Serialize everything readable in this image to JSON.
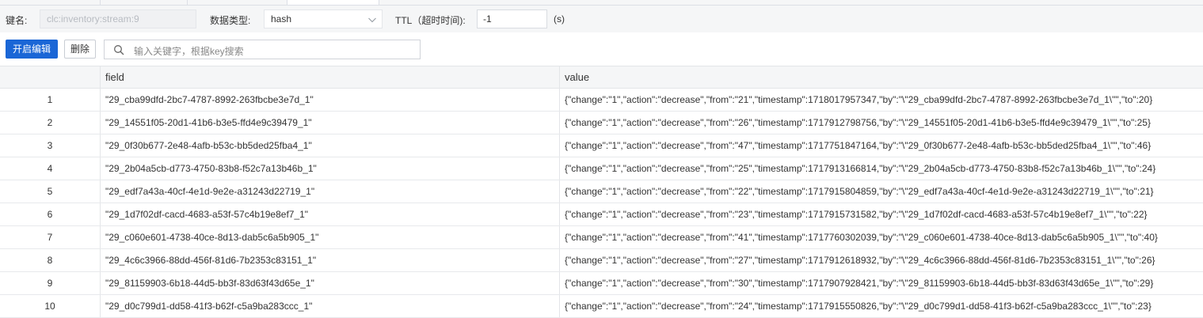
{
  "key_bar": {
    "key_label": "键名:",
    "key_value": "clc:inventory:stream:9",
    "type_label": "数据类型:",
    "type_value": "hash",
    "ttl_label": "TTL（超时时间):",
    "ttl_value": "-1",
    "ttl_unit": "(s)"
  },
  "toolbar": {
    "edit_label": "开启编辑",
    "delete_label": "删除",
    "search_placeholder": "输入关键字，根据key搜索"
  },
  "table": {
    "columns": [
      "field",
      "value"
    ],
    "rows": [
      {
        "index": "1",
        "field": "\"29_cba99dfd-2bc7-4787-8992-263fbcbe3e7d_1\"",
        "value": "{\"change\":\"1\",\"action\":\"decrease\",\"from\":\"21\",\"timestamp\":1718017957347,\"by\":\"\\\"29_cba99dfd-2bc7-4787-8992-263fbcbe3e7d_1\\\"\",\"to\":20}"
      },
      {
        "index": "2",
        "field": "\"29_14551f05-20d1-41b6-b3e5-ffd4e9c39479_1\"",
        "value": "{\"change\":\"1\",\"action\":\"decrease\",\"from\":\"26\",\"timestamp\":1717912798756,\"by\":\"\\\"29_14551f05-20d1-41b6-b3e5-ffd4e9c39479_1\\\"\",\"to\":25}"
      },
      {
        "index": "3",
        "field": "\"29_0f30b677-2e48-4afb-b53c-bb5ded25fba4_1\"",
        "value": "{\"change\":\"1\",\"action\":\"decrease\",\"from\":\"47\",\"timestamp\":1717751847164,\"by\":\"\\\"29_0f30b677-2e48-4afb-b53c-bb5ded25fba4_1\\\"\",\"to\":46}"
      },
      {
        "index": "4",
        "field": "\"29_2b04a5cb-d773-4750-83b8-f52c7a13b46b_1\"",
        "value": "{\"change\":\"1\",\"action\":\"decrease\",\"from\":\"25\",\"timestamp\":1717913166814,\"by\":\"\\\"29_2b04a5cb-d773-4750-83b8-f52c7a13b46b_1\\\"\",\"to\":24}"
      },
      {
        "index": "5",
        "field": "\"29_edf7a43a-40cf-4e1d-9e2e-a31243d22719_1\"",
        "value": "{\"change\":\"1\",\"action\":\"decrease\",\"from\":\"22\",\"timestamp\":1717915804859,\"by\":\"\\\"29_edf7a43a-40cf-4e1d-9e2e-a31243d22719_1\\\"\",\"to\":21}"
      },
      {
        "index": "6",
        "field": "\"29_1d7f02df-cacd-4683-a53f-57c4b19e8ef7_1\"",
        "value": "{\"change\":\"1\",\"action\":\"decrease\",\"from\":\"23\",\"timestamp\":1717915731582,\"by\":\"\\\"29_1d7f02df-cacd-4683-a53f-57c4b19e8ef7_1\\\"\",\"to\":22}"
      },
      {
        "index": "7",
        "field": "\"29_c060e601-4738-40ce-8d13-dab5c6a5b905_1\"",
        "value": "{\"change\":\"1\",\"action\":\"decrease\",\"from\":\"41\",\"timestamp\":1717760302039,\"by\":\"\\\"29_c060e601-4738-40ce-8d13-dab5c6a5b905_1\\\"\",\"to\":40}"
      },
      {
        "index": "8",
        "field": "\"29_4c6c3966-88dd-456f-81d6-7b2353c83151_1\"",
        "value": "{\"change\":\"1\",\"action\":\"decrease\",\"from\":\"27\",\"timestamp\":1717912618932,\"by\":\"\\\"29_4c6c3966-88dd-456f-81d6-7b2353c83151_1\\\"\",\"to\":26}"
      },
      {
        "index": "9",
        "field": "\"29_81159903-6b18-44d5-bb3f-83d63f43d65e_1\"",
        "value": "{\"change\":\"1\",\"action\":\"decrease\",\"from\":\"30\",\"timestamp\":1717907928421,\"by\":\"\\\"29_81159903-6b18-44d5-bb3f-83d63f43d65e_1\\\"\",\"to\":29}"
      },
      {
        "index": "10",
        "field": "\"29_d0c799d1-dd58-41f3-b62f-c5a9ba283ccc_1\"",
        "value": "{\"change\":\"1\",\"action\":\"decrease\",\"from\":\"24\",\"timestamp\":1717915550826,\"by\":\"\\\"29_d0c799d1-dd58-41f3-b62f-c5a9ba283ccc_1\\\"\",\"to\":23}"
      }
    ]
  },
  "icons": {
    "search": "search-icon",
    "dropdown": "chevron-down-icon"
  },
  "colors": {
    "primary": "#1a66d6",
    "toolbar_bg": "#f5f6f7",
    "border": "#e3e5e8"
  }
}
